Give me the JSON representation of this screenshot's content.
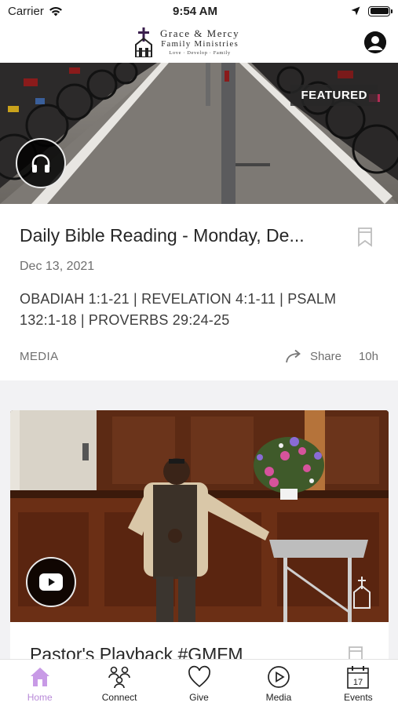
{
  "status_bar": {
    "carrier": "Carrier",
    "time": "9:54 AM"
  },
  "header": {
    "logo_line1": "Grace & Mercy",
    "logo_line2": "Family Ministries",
    "logo_tagline": "Love · Develop · Family"
  },
  "feed": {
    "items": [
      {
        "badge": "FEATURED",
        "media_type_icon": "headphones-icon",
        "title": "Daily Bible Reading - Monday, De...",
        "date": "Dec 13, 2021",
        "description": "OBADIAH 1:1-21 | REVELATION 4:1-11 | PSALM 132:1-18 | PROVERBS 29:24-25",
        "category": "MEDIA",
        "share_label": "Share",
        "age": "10h"
      },
      {
        "media_type_icon": "youtube-play-icon",
        "title": "Pastor's Playback #GMFM"
      }
    ]
  },
  "tabs": [
    {
      "label": "Home",
      "icon": "home-icon",
      "active": true
    },
    {
      "label": "Connect",
      "icon": "people-icon",
      "active": false
    },
    {
      "label": "Give",
      "icon": "heart-icon",
      "active": false
    },
    {
      "label": "Media",
      "icon": "play-circle-icon",
      "active": false
    },
    {
      "label": "Events",
      "icon": "calendar-icon",
      "active": false
    }
  ],
  "colors": {
    "accent": "#b889d8",
    "text": "#262626",
    "muted": "#6f6f6f"
  },
  "calendar_icon_day": "17"
}
